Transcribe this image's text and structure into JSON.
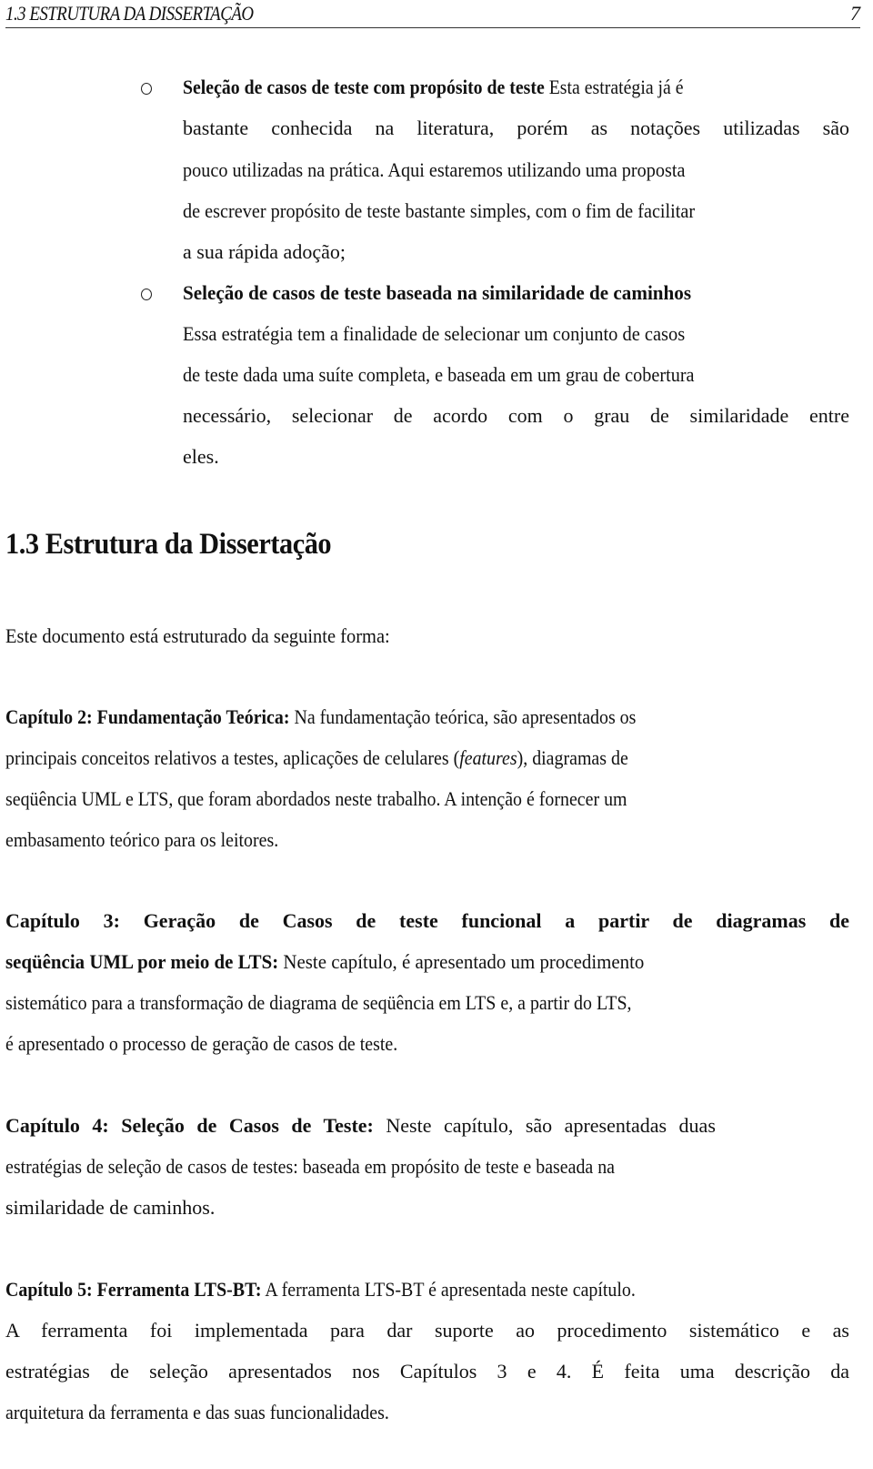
{
  "header": {
    "running_title": "1.3 ESTRUTURA DA DISSERTAÇÃO",
    "page_number": "7"
  },
  "bullets": [
    {
      "title": "Seleção de casos de teste com propósito de teste",
      "lines": [
        " Esta estratégia já é",
        "bastante conhecida na literatura, porém as notações utilizadas são",
        " pouco utilizadas na prática. Aqui estaremos utilizando uma proposta",
        "de escrever propósito de teste bastante simples, com o fim de facilitar",
        "a sua rápida adoção;"
      ]
    },
    {
      "title": "Seleção de casos de teste baseada na similaridade de caminhos",
      "lines": [
        "Essa estratégia tem a finalidade de selecionar um conjunto de casos",
        "de teste dada uma suíte completa, e baseada em um grau de cobertura",
        "necessário, selecionar de acordo com o grau de similaridade entre",
        "eles."
      ]
    }
  ],
  "section": {
    "heading": "1.3 Estrutura da Dissertação",
    "intro": "Este documento está estruturado da seguinte forma:"
  },
  "chapters": [
    {
      "label": "Capítulo 2: Fundamentação Teórica:",
      "line1_rest": " Na fundamentação teórica, são apresentados os",
      "line2_pre": "principais conceitos relativos a testes, aplicações de celulares (",
      "line2_italic": "features",
      "line2_post": "), diagramas de",
      "line3": "seqüência UML e LTS, que foram abordados neste trabalho. A intenção é fornecer um",
      "line4": "embasamento teórico para os leitores."
    },
    {
      "label_line1": "Capítulo 3: Geração de Casos de teste funcional a partir de diagramas de",
      "label_line2": "seqüência UML por meio de LTS:",
      "line2_rest": " Neste capítulo, é apresentado um procedimento",
      "line3": "sistemático para a transformação de diagrama de seqüência em LTS e, a partir do LTS,",
      "line4": "é apresentado o processo de geração de casos de teste."
    },
    {
      "label": "Capítulo 4: Seleção de Casos de Teste:",
      "line1_rest": " Neste capítulo, são apresentadas duas",
      "line2": "estratégias de seleção de casos de testes: baseada em propósito de teste e baseada na",
      "line3": "similaridade de caminhos."
    },
    {
      "label": "Capítulo 5: Ferramenta LTS-BT:",
      "line1_rest": " A ferramenta LTS-BT é apresentada neste capítulo.",
      "line2": "A ferramenta foi implementada para dar suporte ao procedimento sistemático e as",
      "line3": "estratégias de seleção apresentados nos Capítulos 3 e 4. É feita uma descrição da",
      "line4": "arquitetura da ferramenta e das suas funcionalidades."
    }
  ]
}
